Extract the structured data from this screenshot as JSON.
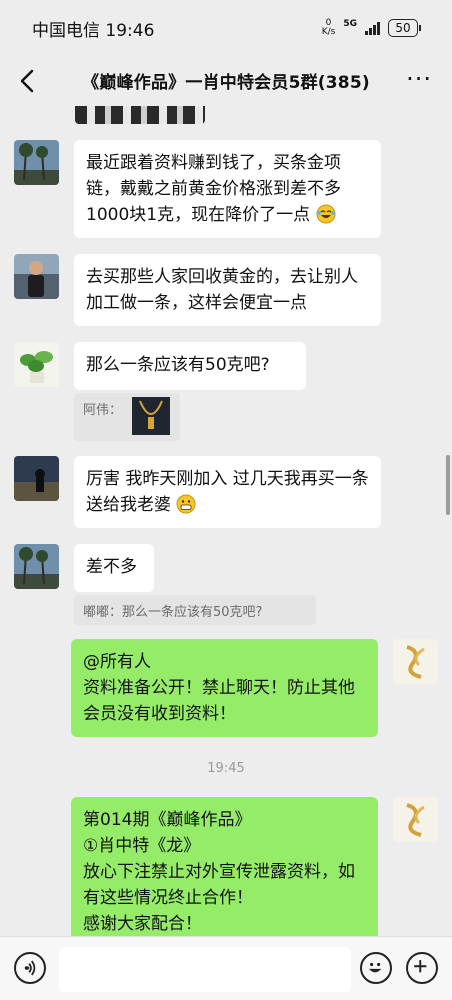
{
  "status_bar": {
    "carrier": "中国电信",
    "time": "19:46",
    "net_speed_value": "0",
    "net_speed_unit": "K/s",
    "network": "5G",
    "battery": "50"
  },
  "header": {
    "title": "《巅峰作品》一肖中特会员5群(385)",
    "back_icon": "chevron-left-icon",
    "more_label": "···"
  },
  "messages": [
    {
      "text": "最近跟着资料赚到钱了，买条金项链，戴戴之前黄金价格涨到差不多1000块1克，现在降价了一点",
      "emoji": "laughing-tears-emoji"
    },
    {
      "text": "去买那些人家回收黄金的，去让别人加工做一条，这样会便宜一点"
    },
    {
      "text": "那么一条应该有50克吧?",
      "quote_name": "阿伟："
    },
    {
      "text": "厉害 我昨天刚加入 过几天我再买一条送给我老婆",
      "emoji": "grinning-emoji"
    },
    {
      "text": "差不多",
      "quote": "嘟嘟：那么一条应该有50克吧?"
    },
    {
      "text": "@所有人\n资料准备公开！禁止聊天！防止其他会员没有收到资料！"
    },
    {
      "text": "第014期《巅峰作品》\n①肖中特《龙》\n放心下注禁止对外宣传泄露资料，如有这些情况终止合作！\n感谢大家配合！"
    }
  ],
  "timestamp": "19:45",
  "input_bar": {
    "voice_icon": "voice-icon",
    "emoji_icon": "emoji-icon",
    "plus_icon": "plus-icon"
  }
}
